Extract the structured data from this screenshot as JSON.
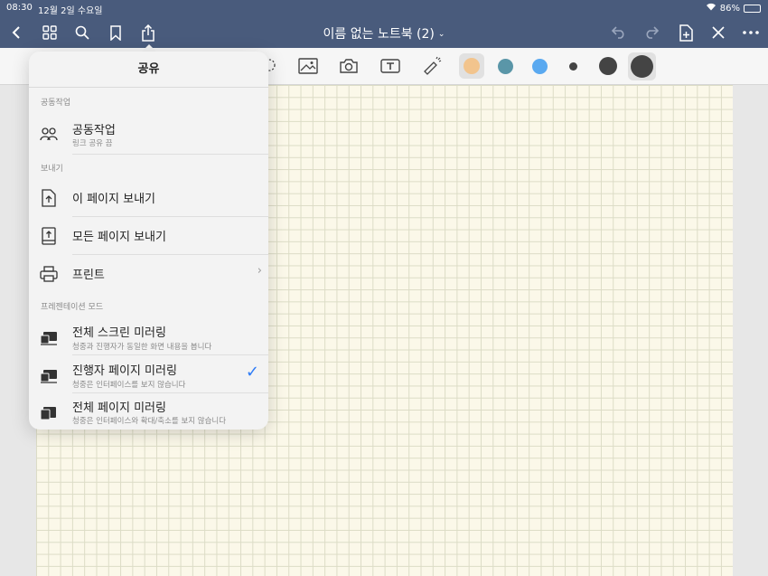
{
  "status": {
    "time": "08:30",
    "date": "12월 2일 수요일",
    "battery": "86%",
    "wifi_icon": "wifi-icon"
  },
  "document": {
    "title": "이름 없는 노트북 (2)",
    "chevron": "⌄"
  },
  "colors": {
    "topbar": "#495b7c",
    "paper": "#fbf8e9",
    "accent": "#2f7cf6"
  },
  "toolbar": {
    "swatches": [
      {
        "name": "peach",
        "color": "#f2c48d",
        "selected": true
      },
      {
        "name": "teal",
        "color": "#5a96a8"
      },
      {
        "name": "sky",
        "color": "#5aa9f0"
      },
      {
        "name": "dark-small",
        "color": "#444444"
      },
      {
        "name": "dark-medium",
        "color": "#444444"
      },
      {
        "name": "dark-large",
        "color": "#444444",
        "selected": true
      }
    ]
  },
  "share_popover": {
    "title": "공유",
    "section_collab": "공동작업",
    "collab": {
      "title": "공동작업",
      "subtitle": "링크 공유 끔"
    },
    "section_export": "보내기",
    "export_page": {
      "title": "이 페이지 보내기"
    },
    "export_all": {
      "title": "모든 페이지 보내기"
    },
    "print": {
      "title": "프린트"
    },
    "section_presentation": "프레젠테이션 모드",
    "mirror_full": {
      "title": "전체 스크린 미러링",
      "subtitle": "청중과 진행자가 동일한 화면 내용을 봅니다"
    },
    "mirror_presenter": {
      "title": "진행자 페이지 미러링",
      "subtitle": "청중은 인터페이스를 보지 않습니다",
      "selected": true
    },
    "mirror_pages": {
      "title": "전체 페이지 미러링",
      "subtitle": "청중은 인터페이스와 확대/축소를 보지 않습니다"
    }
  }
}
